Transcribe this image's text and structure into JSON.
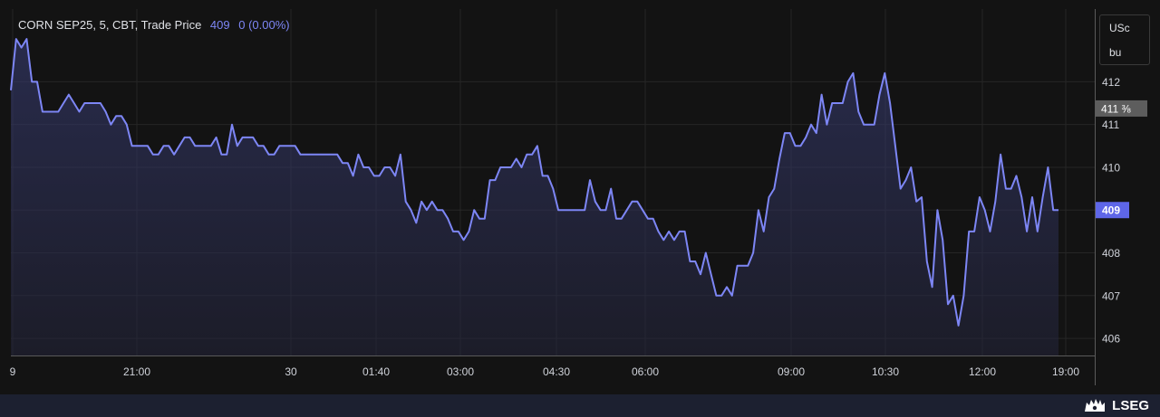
{
  "legend": {
    "title": "CORN SEP25, 5, CBT, Trade Price",
    "last": "409",
    "change": "0 (0.00%)"
  },
  "unit": {
    "line1": "USc",
    "line2": "bu"
  },
  "labels": {
    "high": "411 ⅜",
    "last": "409"
  },
  "brand": {
    "name": "LSEG",
    "icon": "lseg-lion-icon"
  },
  "colors": {
    "line": "#7d86f5",
    "last_badge": "#5e66e8",
    "high_badge": "#5d5d5d"
  },
  "chart_data": {
    "type": "area",
    "ylim": [
      405.6,
      413.7
    ],
    "yticks": [
      406,
      407,
      408,
      409,
      410,
      411,
      412
    ],
    "xticks": [
      "9",
      "21:00",
      "30",
      "01:40",
      "03:00",
      "04:30",
      "06:00",
      "09:00",
      "10:30",
      "12:00",
      "19:00"
    ],
    "grid": true,
    "y": [
      411.8,
      413,
      412.8,
      413,
      412,
      412,
      411.3,
      411.3,
      411.3,
      411.3,
      411.5,
      411.7,
      411.5,
      411.3,
      411.5,
      411.5,
      411.5,
      411.5,
      411.3,
      411,
      411.2,
      411.2,
      411,
      410.5,
      410.5,
      410.5,
      410.5,
      410.3,
      410.3,
      410.5,
      410.5,
      410.3,
      410.5,
      410.7,
      410.7,
      410.5,
      410.5,
      410.5,
      410.5,
      410.7,
      410.3,
      410.3,
      411,
      410.5,
      410.7,
      410.7,
      410.7,
      410.5,
      410.5,
      410.3,
      410.3,
      410.5,
      410.5,
      410.5,
      410.5,
      410.3,
      410.3,
      410.3,
      410.3,
      410.3,
      410.3,
      410.3,
      410.3,
      410.1,
      410.1,
      409.8,
      410.3,
      410,
      410,
      409.8,
      409.8,
      410,
      410,
      409.8,
      410.3,
      409.2,
      409,
      408.7,
      409.2,
      409,
      409.2,
      409,
      409,
      408.8,
      408.5,
      408.5,
      408.3,
      408.5,
      409,
      408.8,
      408.8,
      409.7,
      409.7,
      410,
      410,
      410,
      410.2,
      410,
      410.3,
      410.3,
      410.5,
      409.8,
      409.8,
      409.5,
      409,
      409,
      409,
      409,
      409,
      409,
      409.7,
      409.2,
      409,
      409,
      409.5,
      408.8,
      408.8,
      409,
      409.2,
      409.2,
      409,
      408.8,
      408.8,
      408.5,
      408.3,
      408.5,
      408.3,
      408.5,
      408.5,
      407.8,
      407.8,
      407.5,
      408,
      407.5,
      407,
      407,
      407.2,
      407,
      407.7,
      407.7,
      407.7,
      408,
      409,
      408.5,
      409.3,
      409.5,
      410.2,
      410.8,
      410.8,
      410.5,
      410.5,
      410.7,
      411,
      410.8,
      411.7,
      411,
      411.5,
      411.5,
      411.5,
      412,
      412.2,
      411.3,
      411,
      411,
      411,
      411.7,
      412.2,
      411.5,
      410.5,
      409.5,
      409.7,
      410,
      409.2,
      409.3,
      407.8,
      407.2,
      409,
      408.3,
      406.8,
      407,
      406.3,
      407,
      408.5,
      408.5,
      409.3,
      409,
      408.5,
      409.2,
      410.3,
      409.5,
      409.5,
      409.8,
      409.3,
      408.5,
      409.3,
      408.5,
      409.3,
      410,
      409,
      409
    ]
  }
}
